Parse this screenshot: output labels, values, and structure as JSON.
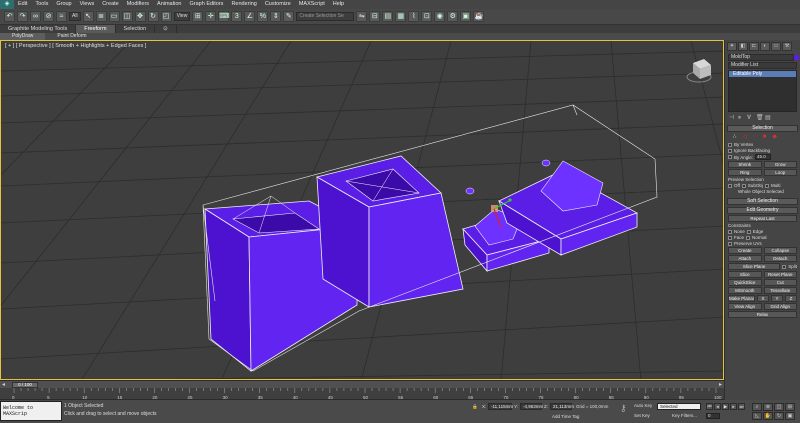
{
  "menubar": {
    "app_icon": "3ds-max-logo",
    "items": [
      "Edit",
      "Tools",
      "Group",
      "Views",
      "Create",
      "Modifiers",
      "Animation",
      "Graph Editors",
      "Rendering",
      "Customize",
      "MAXScript",
      "Help"
    ]
  },
  "toolbar": {
    "filter_value": "All",
    "refcoord_value": "View",
    "selection_set_placeholder": "Create Selection Se"
  },
  "ribbon": {
    "tabs": [
      "Graphite Modeling Tools",
      "Freeform",
      "Selection"
    ],
    "active_tab": "Freeform",
    "subtabs": [
      "PolyDraw",
      "Paint Deform"
    ],
    "active_subtab": "PolyDraw"
  },
  "viewport": {
    "label": "[ + ] [ Perspective ] [ Smooth + Highlights + Edged Faces ]",
    "object_color": "#5a1ee6",
    "wire_color": "#f0f0f0",
    "grid_color": "#2d2d2d",
    "bg_color": "#3e3e3e"
  },
  "panel": {
    "object_name": "MoldTop",
    "modifier_list": "Modifier List",
    "stack_item": "Editable Poly",
    "selection": {
      "title": "Selection",
      "by_vertex": "By Vertex",
      "ignore_backfacing": "Ignore Backfacing",
      "by_angle": "By Angle:",
      "by_angle_value": "45.0",
      "shrink": "Shrink",
      "grow": "Grow",
      "ring": "Ring",
      "loop": "Loop",
      "preview_label": "Preview Selection",
      "off": "Off",
      "subobj": "SubObj",
      "multi": "Multi",
      "whole_object": "Whole Object Selected"
    },
    "soft_selection": "Soft Selection",
    "edit_geometry": {
      "title": "Edit Geometry",
      "repeat_last": "Repeat Last",
      "constraints": "Constraints",
      "none": "None",
      "edge": "Edge",
      "face": "Face",
      "normal": "Normal",
      "preserve_uvs": "Preserve UVs",
      "create": "Create",
      "collapse": "Collapse",
      "attach": "Attach",
      "detach": "Detach",
      "slice_plane": "Slice Plane",
      "split": "Split",
      "slice": "Slice",
      "reset_plane": "Reset Plane",
      "quickslice": "QuickSlice",
      "cut": "Cut",
      "msmooth": "MSmooth",
      "tessellate": "Tessellate",
      "make_planar": "Make Planar",
      "x": "X",
      "y": "Y",
      "z": "Z",
      "view_align": "View Align",
      "grid_align": "Grid Align",
      "relax": "Relax"
    }
  },
  "timeline": {
    "frame_display": "0 / 100",
    "ticks": [
      "0",
      "5",
      "10",
      "15",
      "20",
      "25",
      "30",
      "35",
      "40",
      "45",
      "50",
      "55",
      "60",
      "65",
      "70",
      "75",
      "80",
      "85",
      "90",
      "95",
      "100"
    ]
  },
  "status": {
    "maxscript_line": "Welcome to MAXScrip",
    "objects_selected": "1 Object Selected",
    "prompt": "Click and drag to select and move objects",
    "x_label": "X:",
    "x_value": "-11,115mm",
    "y_label": "Y:",
    "y_value": "-4,963mm",
    "z_label": "Z:",
    "z_value": "21,113mm",
    "grid": "Grid = 100,0mm",
    "add_time_tag": "Add Time Tag",
    "auto_key": "Auto Key",
    "set_key": "Set Key",
    "key_mode": "Selected",
    "key_filters": "Key Filters...",
    "frame_value": "0"
  }
}
